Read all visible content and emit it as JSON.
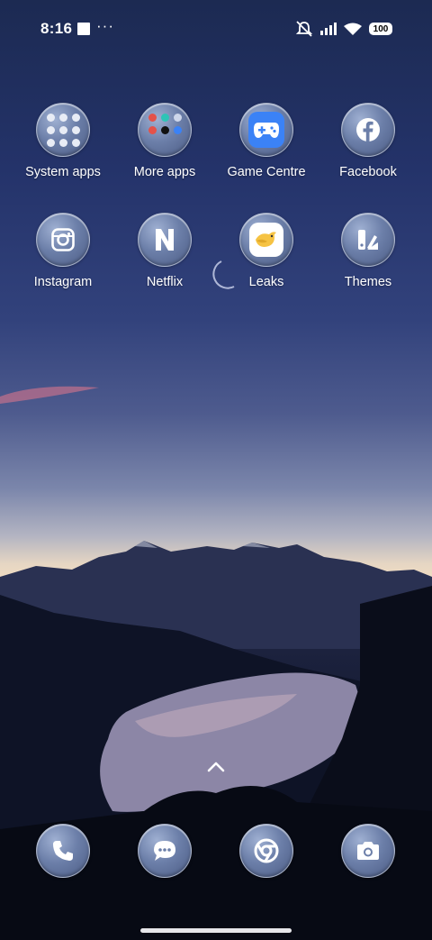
{
  "status_bar": {
    "time": "8:16",
    "battery": "100",
    "icons": [
      "mute-icon",
      "signal-icon",
      "wifi-icon",
      "battery-icon"
    ]
  },
  "apps_row1": [
    {
      "label": "System apps",
      "icon": "folder-icon"
    },
    {
      "label": "More apps",
      "icon": "folder-icon"
    },
    {
      "label": "Game Centre",
      "icon": "game-controller-icon"
    },
    {
      "label": "Facebook",
      "icon": "facebook-icon"
    }
  ],
  "apps_row2": [
    {
      "label": "Instagram",
      "icon": "instagram-icon"
    },
    {
      "label": "Netflix",
      "icon": "netflix-icon"
    },
    {
      "label": "Leaks",
      "icon": "leaks-bird-icon"
    },
    {
      "label": "Themes",
      "icon": "themes-icon"
    }
  ],
  "dock": [
    {
      "icon": "phone-icon"
    },
    {
      "icon": "messages-icon"
    },
    {
      "icon": "chrome-icon"
    },
    {
      "icon": "camera-icon"
    }
  ],
  "colors": {
    "icon_bubble": "#6c7fa9",
    "game_centre": "#3b82f6",
    "leaks_bird": "#f6c343"
  }
}
